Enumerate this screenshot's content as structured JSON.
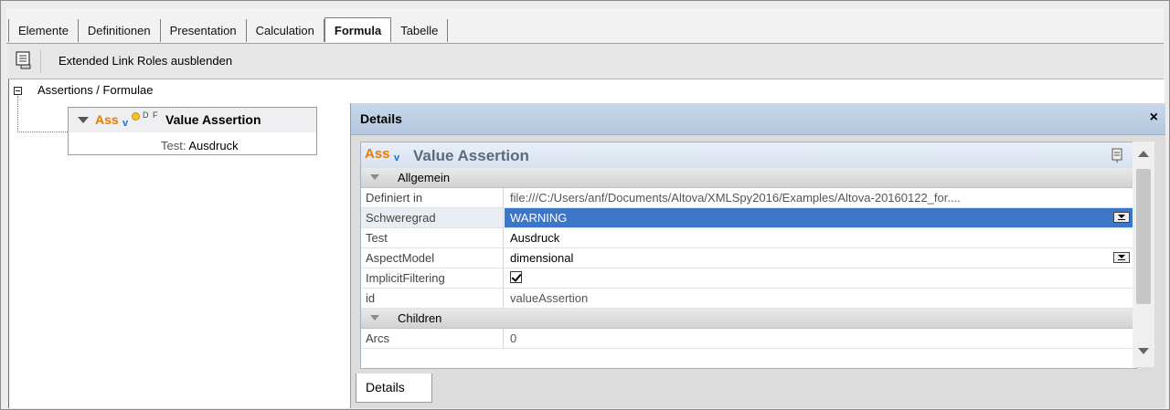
{
  "tabs": [
    "Elemente",
    "Definitionen",
    "Presentation",
    "Calculation",
    "Formula",
    "Tabelle"
  ],
  "active_tab": "Formula",
  "toolbar": {
    "label": "Extended Link Roles ausblenden",
    "icon": "hide-roles-icon"
  },
  "tree": {
    "root_label": "Assertions / Formulae",
    "node": {
      "prefix": "Ass",
      "subscript": "v",
      "flags": "D F",
      "title": "Value Assertion",
      "test_label": "Test:",
      "test_value": "Ausdruck"
    }
  },
  "details": {
    "header": "Details",
    "close": "×",
    "grid_prefix": "Ass",
    "grid_subscript": "v",
    "grid_title": "Value Assertion",
    "section_general": "Allgemein",
    "section_children": "Children",
    "rows": [
      {
        "key": "Definiert in",
        "value": "file:///C:/Users/anf/Documents/Altova/XMLSpy2016/Examples/Altova-20160122_for...."
      },
      {
        "key": "Schweregrad",
        "value": "WARNING"
      },
      {
        "key": "Test",
        "value": "Ausdruck"
      },
      {
        "key": "AspectModel",
        "value": "dimensional"
      },
      {
        "key": "ImplicitFiltering",
        "value": ""
      },
      {
        "key": "id",
        "value": "valueAssertion"
      },
      {
        "key": "Arcs",
        "value": "0"
      }
    ],
    "bottom_tab": "Details"
  },
  "colors": {
    "ass": "#e67e00",
    "subscript": "#1a6fcf",
    "selection": "#3b76c8",
    "header": "#b3c7de"
  }
}
